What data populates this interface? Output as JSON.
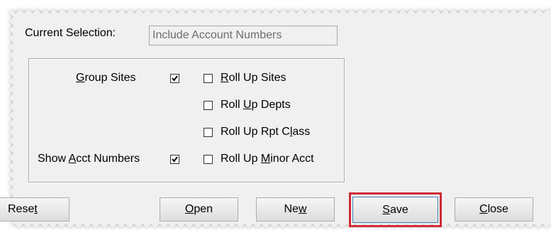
{
  "current_selection": {
    "label": "Current Selection:",
    "value": "Include Account Numbers"
  },
  "options": {
    "group_sites": {
      "label_before": "",
      "mnemonic": "G",
      "label_after": "roup Sites",
      "checked": true
    },
    "show_acct_numbers": {
      "label_before": "Show ",
      "mnemonic": "A",
      "label_after": "cct Numbers",
      "checked": true
    },
    "roll_up_sites": {
      "label_before": "",
      "mnemonic": "R",
      "label_after": "oll Up Sites",
      "checked": false
    },
    "roll_up_depts": {
      "label_before": "Roll ",
      "mnemonic": "U",
      "label_after": "p Depts",
      "checked": false
    },
    "roll_up_rpt_class": {
      "label_before": "Roll Up Rpt C",
      "mnemonic": "l",
      "label_after": "ass",
      "checked": false
    },
    "roll_up_minor_acct": {
      "label_before": "Roll Up ",
      "mnemonic": "M",
      "label_after": "inor Acct",
      "checked": false
    }
  },
  "buttons": {
    "reset": {
      "label_before": "Rese",
      "mnemonic": "t",
      "label_after": ""
    },
    "open": {
      "label_before": "",
      "mnemonic": "O",
      "label_after": "pen"
    },
    "new": {
      "label_before": "Ne",
      "mnemonic": "w",
      "label_after": ""
    },
    "save": {
      "label_before": "",
      "mnemonic": "S",
      "label_after": "ave"
    },
    "close": {
      "label_before": "",
      "mnemonic": "C",
      "label_after": "lose"
    }
  },
  "colors": {
    "dialog_background": "#f0f0f0",
    "highlight_border": "#cf2b36",
    "checkmark": "#000000"
  }
}
